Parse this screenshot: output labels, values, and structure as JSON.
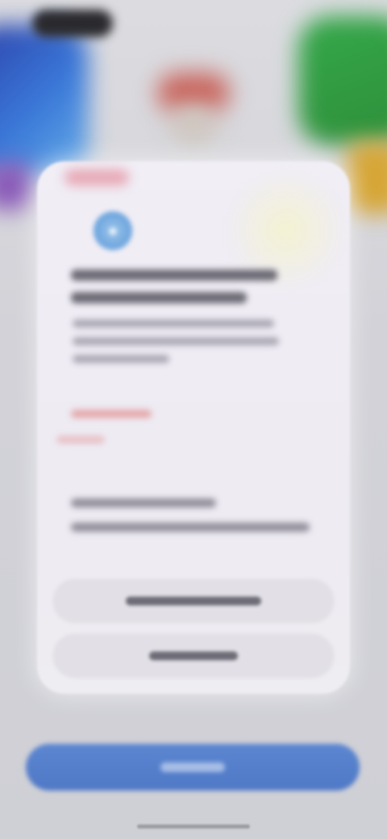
{
  "screen": {
    "background": "#d3d3d8"
  },
  "status_bar": {
    "pill_icon": "dynamic-island"
  },
  "sheet": {
    "app_icon": "app-badge-icon",
    "title": "",
    "body": "",
    "link": "",
    "note": "",
    "accent_color": "#e3a6a8"
  },
  "buttons": {
    "secondary_1": "",
    "secondary_2": "",
    "primary": "",
    "primary_color": "#5379c8"
  }
}
